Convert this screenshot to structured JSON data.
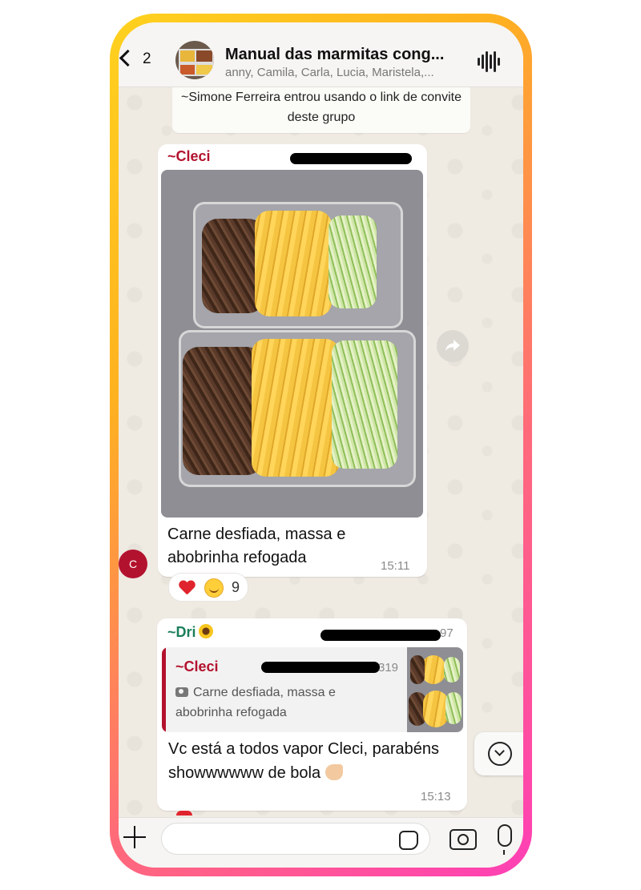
{
  "header": {
    "back_count": "2",
    "title": "Manual das marmitas cong...",
    "subtitle": "anny, Camila, Carla, Lucia, Maristela,..."
  },
  "system_message": "~Simone Ferreira entrou usando o link de convite deste grupo",
  "messages": [
    {
      "sender": "~Cleci",
      "sender_color": "#b3122e",
      "caption": "Carne desfiada, massa e abobrinha refogada",
      "time": "15:11",
      "avatar_letter": "C",
      "reactions": {
        "emojis": [
          "heart",
          "smiling-face"
        ],
        "count": "9"
      }
    },
    {
      "sender": "~Dri",
      "sender_color": "#1a7f5a",
      "phone_suffix": "97",
      "quote": {
        "sender": "~Cleci",
        "phone_suffix": "319",
        "text": "Carne desfiada, massa e abobrinha refogada"
      },
      "text": "Vc está a todos vapor Cleci, parabéns showwwwww de bola",
      "time": "15:13"
    }
  ],
  "icons": [
    "back-chevron",
    "voice-wave",
    "forward-arrow",
    "scroll-down-chevron",
    "plus",
    "sticker",
    "camera",
    "microphone",
    "camera-small"
  ]
}
